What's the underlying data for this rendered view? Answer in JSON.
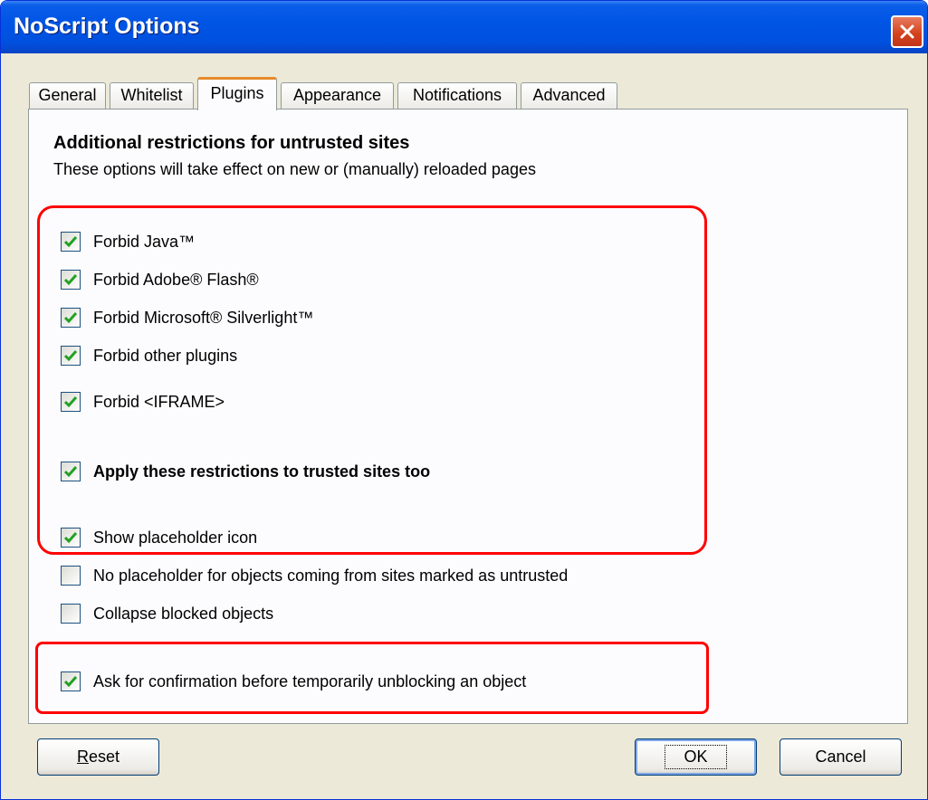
{
  "window": {
    "title": "NoScript Options"
  },
  "tabs": [
    {
      "label": "General",
      "active": false
    },
    {
      "label": "Whitelist",
      "active": false
    },
    {
      "label": "Plugins",
      "active": true
    },
    {
      "label": "Appearance",
      "active": false
    },
    {
      "label": "Notifications",
      "active": false
    },
    {
      "label": "Advanced",
      "active": false
    }
  ],
  "panel": {
    "heading": "Additional restrictions for untrusted sites",
    "subheading": "These options will take effect on new or (manually) reloaded pages"
  },
  "options": [
    {
      "label": "Forbid Java™",
      "checked": true
    },
    {
      "label": "Forbid Adobe® Flash®",
      "checked": true
    },
    {
      "label": "Forbid Microsoft® Silverlight™",
      "checked": true
    },
    {
      "label": "Forbid other plugins",
      "checked": true
    },
    {
      "label": "Forbid <IFRAME>",
      "checked": true
    },
    {
      "label": "Apply these restrictions to trusted sites too",
      "checked": true
    },
    {
      "label": "Show placeholder icon",
      "checked": true
    },
    {
      "label": "No placeholder for objects coming from sites marked as untrusted",
      "checked": false
    },
    {
      "label": "Collapse blocked objects",
      "checked": false
    },
    {
      "label": "Ask for confirmation before temporarily unblocking an object",
      "checked": true
    }
  ],
  "buttons": {
    "reset": "Reset",
    "ok": "OK",
    "cancel": "Cancel"
  },
  "icons": {
    "close": "close-icon",
    "checkmark": "checkmark-icon"
  },
  "colors": {
    "titlebar": "#0055e5",
    "highlight": "#ff0000",
    "check": "#21a121",
    "active_tab_accent": "#e68b2c"
  }
}
